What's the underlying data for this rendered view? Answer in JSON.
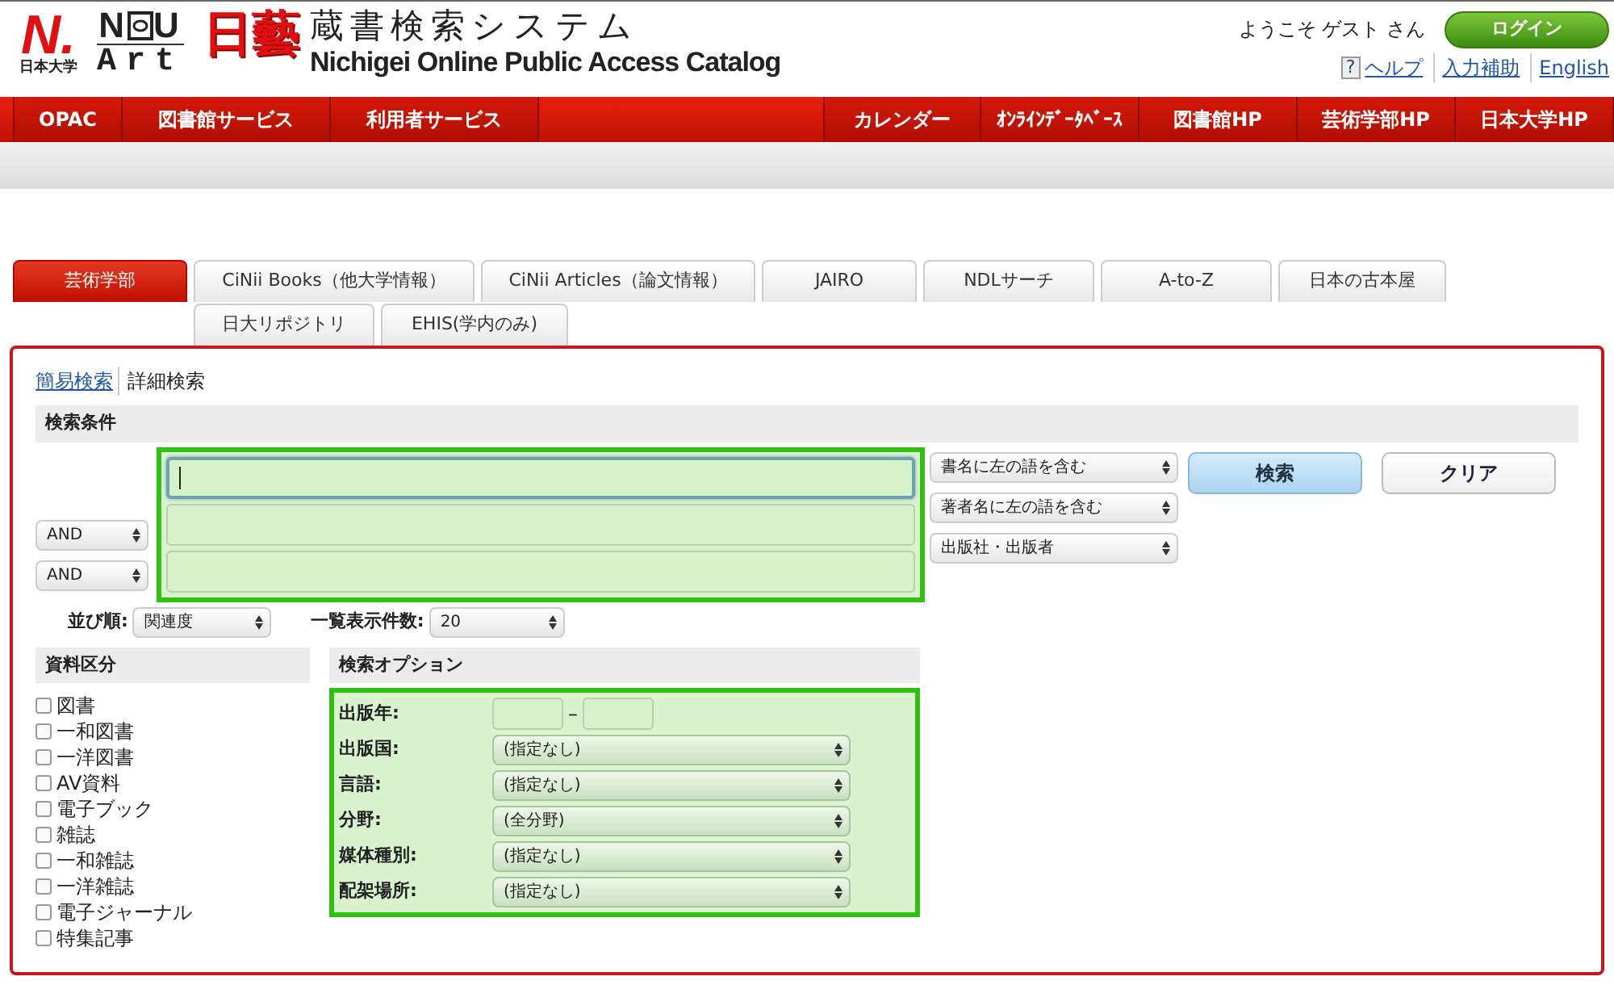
{
  "header": {
    "university_mark": "N.",
    "university_name": "日本大学",
    "college_mark_left": "N",
    "college_mark_right": "U",
    "college_word": "Art",
    "brand_kanji": "日藝",
    "system_title": "蔵書検索システム",
    "system_subtitle": "Nichigei Online Public Access Catalog"
  },
  "user_bar": {
    "welcome": "ようこそ ゲスト さん",
    "login_button": "ログイン",
    "help_icon": "?",
    "links": [
      "ヘルプ",
      "入力補助",
      "English"
    ]
  },
  "nav_left": [
    "OPAC",
    "図書館サービス",
    "利用者サービス"
  ],
  "nav_right": [
    "カレンダー",
    "ｵﾝﾗｲﾝﾃﾞｰﾀﾍﾞｰｽ",
    "図書館HP",
    "芸術学部HP",
    "日本大学HP"
  ],
  "tabs": [
    {
      "label": "芸術学部",
      "selected": true
    },
    {
      "label": "CiNii Books（他大学情報）",
      "selected": false
    },
    {
      "label": "CiNii Articles（論文情報）",
      "selected": false
    },
    {
      "label": "JAIRO",
      "selected": false
    },
    {
      "label": "NDLサーチ",
      "selected": false
    },
    {
      "label": "A-to-Z",
      "selected": false
    },
    {
      "label": "日本の古本屋",
      "selected": false
    },
    {
      "label": "日大リポジトリ",
      "selected": false
    },
    {
      "label": "EHIS(学内のみ)",
      "selected": false
    }
  ],
  "search_modes": [
    {
      "label": "簡易検索",
      "selected": false
    },
    {
      "label": "詳細検索",
      "selected": true
    }
  ],
  "conditions": {
    "title": "検索条件",
    "rows": [
      {
        "focused": true,
        "field": "書名に左の語を含む"
      },
      {
        "operator": "AND",
        "focused": false,
        "field": "著者名に左の語を含む"
      },
      {
        "operator": "AND",
        "focused": false,
        "field": "出版社・出版者"
      }
    ],
    "search_button": "検索",
    "clear_button": "クリア",
    "sort_label": "並び順:",
    "sort_value": "関連度",
    "count_label": "一覧表示件数:",
    "count_value": "20"
  },
  "material_types": {
    "title": "資料区分",
    "items": [
      {
        "label": "図書",
        "checked": false
      },
      {
        "label": "一和図書",
        "checked": false
      },
      {
        "label": "一洋図書",
        "checked": false
      },
      {
        "label": "AV資料",
        "checked": false
      },
      {
        "label": "電子ブック",
        "checked": false
      },
      {
        "label": "雑誌",
        "checked": false
      },
      {
        "label": "一和雑誌",
        "checked": false
      },
      {
        "label": "一洋雑誌",
        "checked": false
      },
      {
        "label": "電子ジャーナル",
        "checked": false
      },
      {
        "label": "特集記事",
        "checked": false
      }
    ]
  },
  "options": {
    "title": "検索オプション",
    "rows": [
      {
        "kind": "range",
        "label": "出版年:",
        "separator": "–"
      },
      {
        "kind": "select",
        "label": "出版国:",
        "value": "(指定なし)"
      },
      {
        "kind": "select",
        "label": "言語:",
        "value": "(指定なし)"
      },
      {
        "kind": "select",
        "label": "分野:",
        "value": "(全分野)"
      },
      {
        "kind": "select",
        "label": "媒体種別:",
        "value": "(指定なし)"
      },
      {
        "kind": "select",
        "label": "配架場所:",
        "value": "(指定なし)"
      }
    ]
  }
}
